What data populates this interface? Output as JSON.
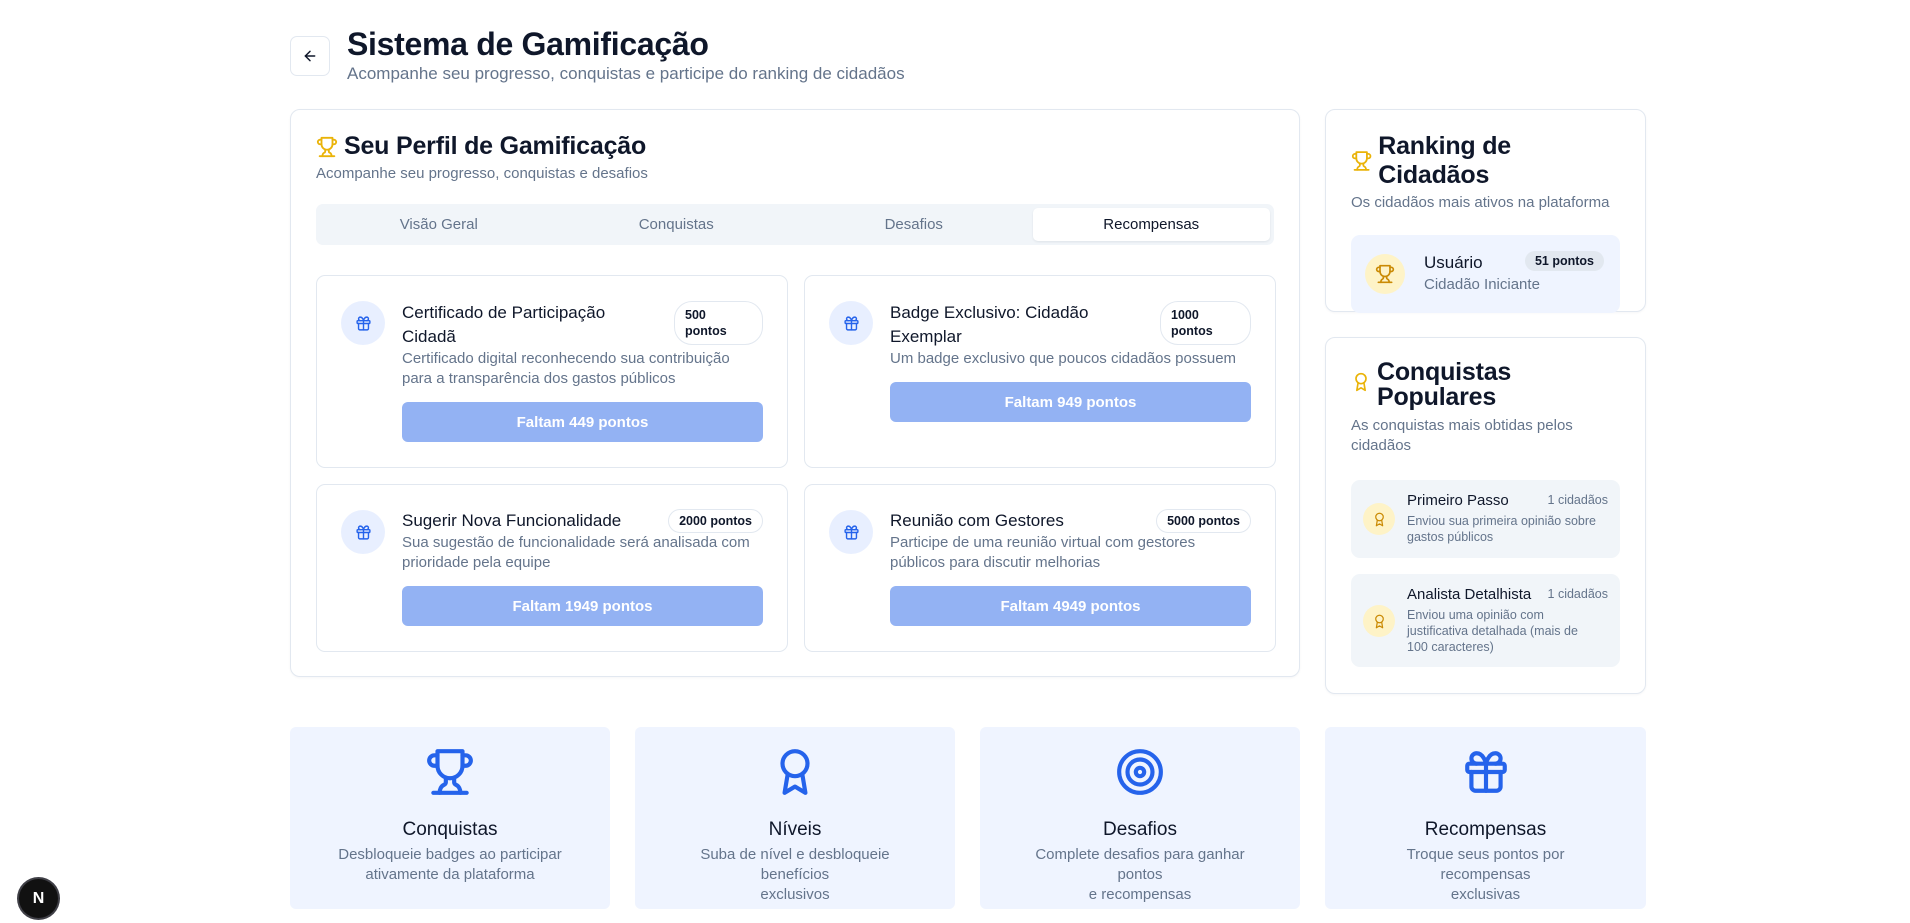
{
  "header": {
    "title": "Sistema de Gamificação",
    "subtitle": "Acompanhe seu progresso, conquistas e participe do ranking de cidadãos"
  },
  "profile": {
    "title": "Seu Perfil de Gamificação",
    "description": "Acompanhe seu progresso, conquistas e desafios",
    "tabs": [
      {
        "label": "Visão Geral",
        "active": false
      },
      {
        "label": "Conquistas",
        "active": false
      },
      {
        "label": "Desafios",
        "active": false
      },
      {
        "label": "Recompensas",
        "active": true
      }
    ],
    "rewards": [
      {
        "title_line1": "Certificado de Participação",
        "title_line2": "Cidadã",
        "points_line1": "500",
        "points_line2": "pontos",
        "desc_line1": "Certificado digital reconhecendo sua contribuição",
        "desc_line2": "para a transparência dos gastos públicos",
        "button": "Faltam 449 pontos"
      },
      {
        "title_line1": "Badge Exclusivo: Cidadão",
        "title_line2": "Exemplar",
        "points_line1": "1000",
        "points_line2": "pontos",
        "desc_line1": "Um badge exclusivo que poucos cidadãos possuem",
        "button": "Faltam 949 pontos"
      },
      {
        "title_line1": "Sugerir Nova Funcionalidade",
        "points": "2000 pontos",
        "desc_line1": "Sua sugestão de funcionalidade será analisada com",
        "desc_line2": "prioridade pela equipe",
        "button": "Faltam 1949 pontos"
      },
      {
        "title_line1": "Reunião com Gestores",
        "points": "5000 pontos",
        "desc_line1": "Participe de uma reunião virtual com gestores",
        "desc_line2": "públicos para discutir melhorias",
        "button": "Faltam 4949 pontos"
      }
    ]
  },
  "ranking": {
    "title": "Ranking de Cidadãos",
    "description": "Os cidadãos mais ativos na plataforma",
    "entries": [
      {
        "name": "Usuário",
        "level": "Cidadão Iniciante",
        "points": "51 pontos"
      }
    ]
  },
  "popular": {
    "title_line1": "Conquistas",
    "title_line2": "Populares",
    "desc_line1": "As conquistas mais obtidas pelos",
    "desc_line2": "cidadãos",
    "items": [
      {
        "name": "Primeiro Passo",
        "count": "1 cidadãos",
        "desc_line1": "Enviou sua primeira opinião sobre",
        "desc_line2": "gastos públicos"
      },
      {
        "name": "Analista Detalhista",
        "count": "1 cidadãos",
        "desc_line1": "Enviou uma opinião com",
        "desc_line2": "justificativa detalhada (mais de",
        "desc_line3": "100 caracteres)"
      }
    ]
  },
  "features": [
    {
      "icon": "trophy-icon",
      "title": "Conquistas",
      "desc_line1": "Desbloqueie badges ao participar",
      "desc_line2": "ativamente da plataforma"
    },
    {
      "icon": "award-icon",
      "title": "Níveis",
      "desc_line1": "Suba de nível e desbloqueie benefícios",
      "desc_line2": "exclusivos"
    },
    {
      "icon": "target-icon",
      "title": "Desafios",
      "desc_line1": "Complete desafios para ganhar pontos",
      "desc_line2": "e recompensas"
    },
    {
      "icon": "gift-icon",
      "title": "Recompensas",
      "desc_line1": "Troque seus pontos por recompensas",
      "desc_line2": "exclusivas"
    }
  ],
  "dev_badge": "N",
  "colors": {
    "accent": "#2563eb",
    "gold": "#eab308",
    "button_disabled": "#93b2f3"
  }
}
